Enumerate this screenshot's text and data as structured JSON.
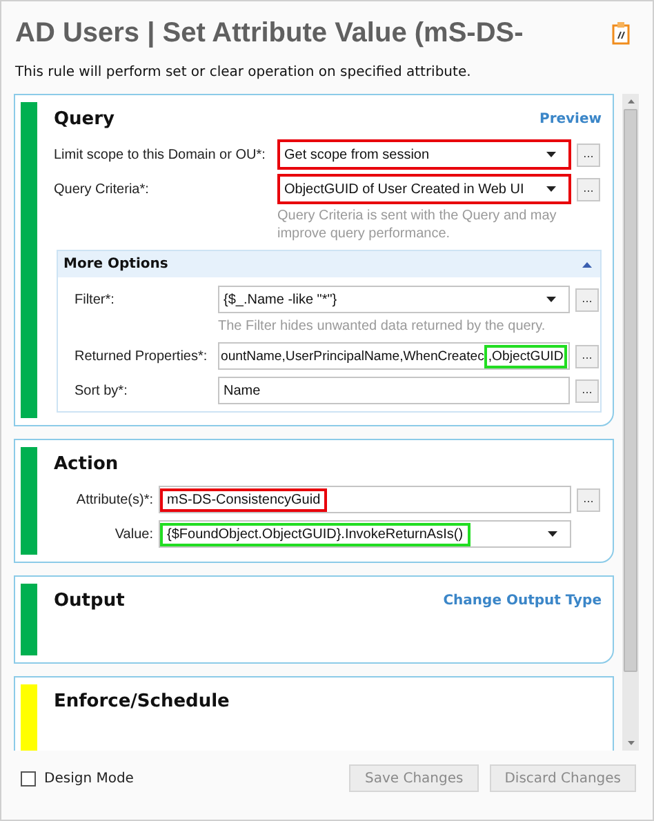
{
  "window": {
    "title": "AD Users | Set Attribute Value (mS-DS-"
  },
  "description": "This rule will perform set or clear operation on specified attribute.",
  "sections": [
    {
      "title": "Query",
      "color": "#00b050",
      "link": "Preview",
      "fields": [
        {
          "kind": "dropdown",
          "label": "Limit scope to this Domain or OU*:",
          "value": "Get scope from session",
          "browse": "...",
          "highlight": {
            "color": "#e8000b",
            "kind": "field"
          }
        },
        {
          "kind": "dropdown",
          "label": "Query Criteria*:",
          "value": "ObjectGUID of User Created in Web UI",
          "browse": "...",
          "highlight": {
            "color": "#e8000b",
            "kind": "field"
          },
          "hint": "Query Criteria is sent with the Query and may improve query performance."
        }
      ],
      "more_options": {
        "title": "More Options",
        "expanded": true,
        "fields": [
          {
            "kind": "dropdown",
            "label": "Filter*:",
            "value": "{$_.Name -like \"*\"}",
            "browse": "...",
            "hint": "The Filter hides unwanted data returned by the query."
          },
          {
            "kind": "text",
            "label": "Returned Properties*:",
            "value": "ountName,UserPrincipalName,WhenCreatec",
            "browse": "...",
            "highlight": {
              "color": "#22dd22",
              "kind": "tail",
              "text": ",ObjectGUID"
            }
          },
          {
            "kind": "text",
            "label": "Sort by*:",
            "value": "Name",
            "browse": "..."
          }
        ]
      }
    },
    {
      "title": "Action",
      "color": "#00b050",
      "fields": [
        {
          "kind": "text",
          "label": "Attribute(s)*:",
          "value": "mS-DS-ConsistencyGuid",
          "browse": "...",
          "highlight": {
            "color": "#e8000b",
            "kind": "value"
          }
        },
        {
          "kind": "dropdown",
          "label": "Value:",
          "value": "{$FoundObject.ObjectGUID}.InvokeReturnAsIs()",
          "highlight": {
            "color": "#22dd22",
            "kind": "value"
          }
        }
      ]
    },
    {
      "title": "Output",
      "color": "#00b050",
      "link": "Change Output Type"
    },
    {
      "title": "Enforce/Schedule",
      "color": "#ffff00"
    }
  ],
  "footer": {
    "design_mode": {
      "label": "Design Mode",
      "checked": false
    },
    "buttons": [
      {
        "label": "Save Changes",
        "disabled": true
      },
      {
        "label": "Discard Changes",
        "disabled": true
      }
    ]
  }
}
